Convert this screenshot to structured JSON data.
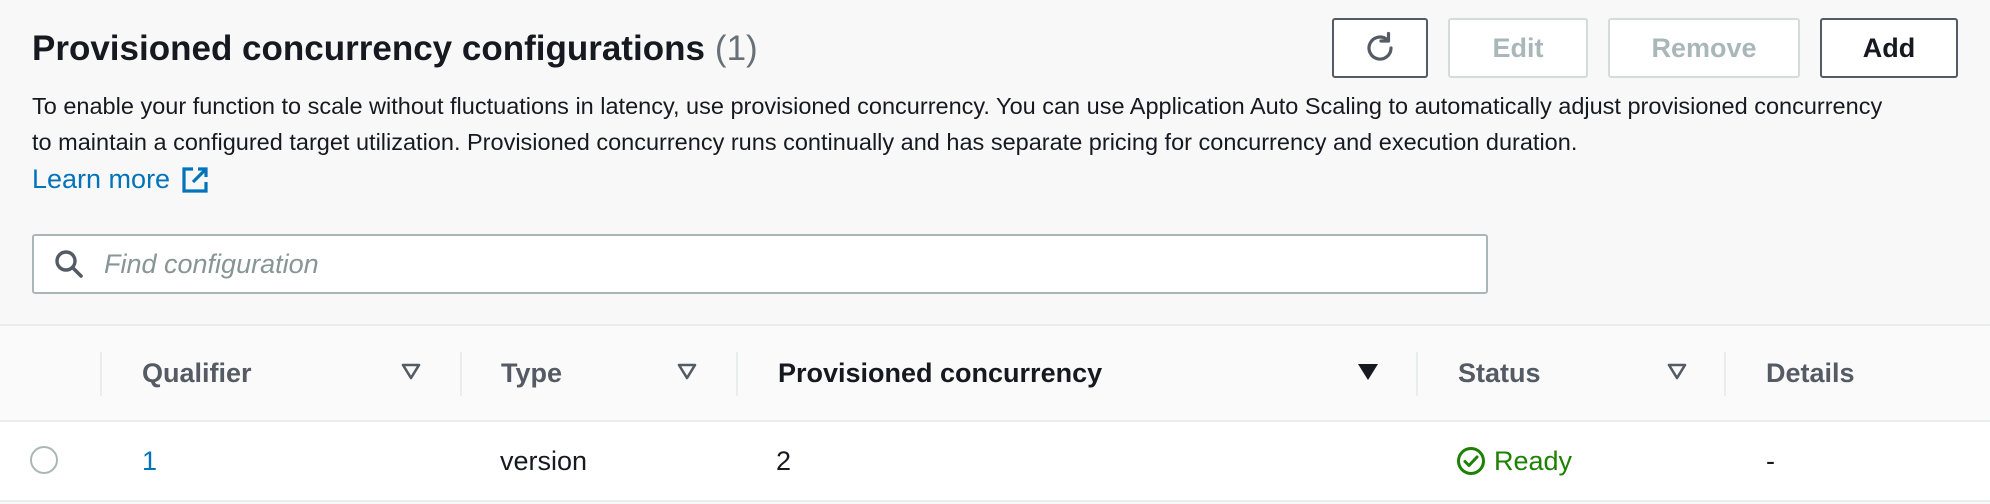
{
  "section": {
    "title": "Provisioned concurrency configurations",
    "count": "(1)",
    "description": "To enable your function to scale without fluctuations in latency, use provisioned concurrency. You can use Application Auto Scaling to automatically adjust provisioned concurrency to maintain a configured target utilization. Provisioned concurrency runs continually and has separate pricing for concurrency and execution duration.",
    "learn_more": "Learn more"
  },
  "toolbar": {
    "refresh_icon": "refresh-icon",
    "edit_label": "Edit",
    "remove_label": "Remove",
    "add_label": "Add"
  },
  "search": {
    "placeholder": "Find configuration",
    "value": ""
  },
  "table": {
    "columns": [
      {
        "label": "Qualifier",
        "sort": "unsorted"
      },
      {
        "label": "Type",
        "sort": "unsorted"
      },
      {
        "label": "Provisioned concurrency",
        "sort": "descending"
      },
      {
        "label": "Status",
        "sort": "unsorted"
      },
      {
        "label": "Details",
        "sort": "none"
      }
    ],
    "rows": [
      {
        "selected": false,
        "qualifier": "1",
        "type": "version",
        "provisioned_concurrency": "2",
        "status": "Ready",
        "details": "-"
      }
    ]
  },
  "colors": {
    "link": "#0073bb",
    "success": "#1d8102",
    "text": "#16191f",
    "muted": "#687078"
  }
}
